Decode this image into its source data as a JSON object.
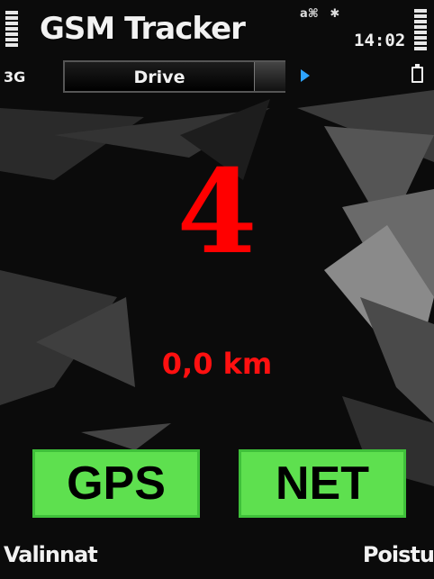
{
  "status_bar": {
    "app_title": "GSM Tracker",
    "indicator_1": "a⌘",
    "indicator_2": "✱",
    "clock": "14:02",
    "network_type": "3G"
  },
  "mode_selector": {
    "value": "Drive"
  },
  "readout": {
    "count": "4",
    "distance": "0,0 km"
  },
  "buttons": {
    "gps_label": "GPS",
    "net_label": "NET"
  },
  "softkeys": {
    "left": "Valinnat",
    "right": "Poistu"
  },
  "colors": {
    "readout": "#ff0000",
    "button_bg": "#5ee04f",
    "arrow": "#2ea3ff"
  },
  "icons": [
    "signal-strength-icon",
    "battery-level-icon",
    "battery-icon",
    "scroll-right-arrow-icon"
  ]
}
